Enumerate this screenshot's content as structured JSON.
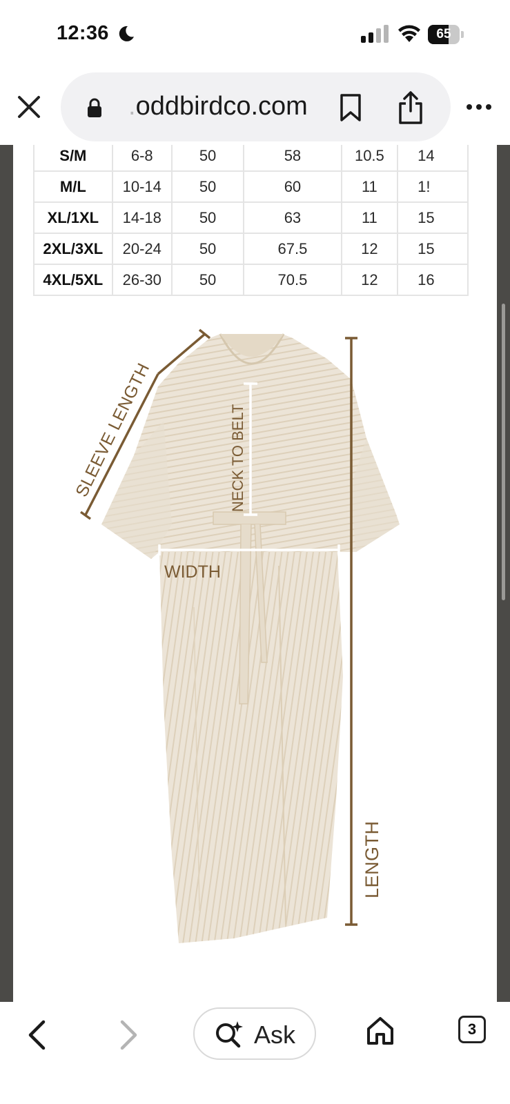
{
  "status_bar": {
    "time": "12:36",
    "battery_percent": "65",
    "battery_level": 0.65
  },
  "address_bar": {
    "url_faded_prefix": ".",
    "url": "oddbirdco.com"
  },
  "size_table": {
    "rows": [
      [
        "S/M",
        "6-8",
        "50",
        "58",
        "10.5",
        "14"
      ],
      [
        "M/L",
        "10-14",
        "50",
        "60",
        "11",
        "1!"
      ],
      [
        "XL/1XL",
        "14-18",
        "50",
        "63",
        "11",
        "15"
      ],
      [
        "2XL/3XL",
        "20-24",
        "50",
        "67.5",
        "12",
        "15"
      ],
      [
        "4XL/5XL",
        "26-30",
        "50",
        "70.5",
        "12",
        "16"
      ]
    ]
  },
  "garment_diagram": {
    "labels": {
      "sleeve_length": "SLEEVE  LENGTH",
      "neck_to_belt": "NECK TO BELT",
      "width": "WIDTH",
      "length": "LENGTH"
    },
    "colors": {
      "fabric": "#ebe3d6",
      "stripe": "#dccdb5",
      "measure": "#7a5b34"
    }
  },
  "bottom_bar": {
    "ask_label": "Ask",
    "tab_count": "3"
  }
}
